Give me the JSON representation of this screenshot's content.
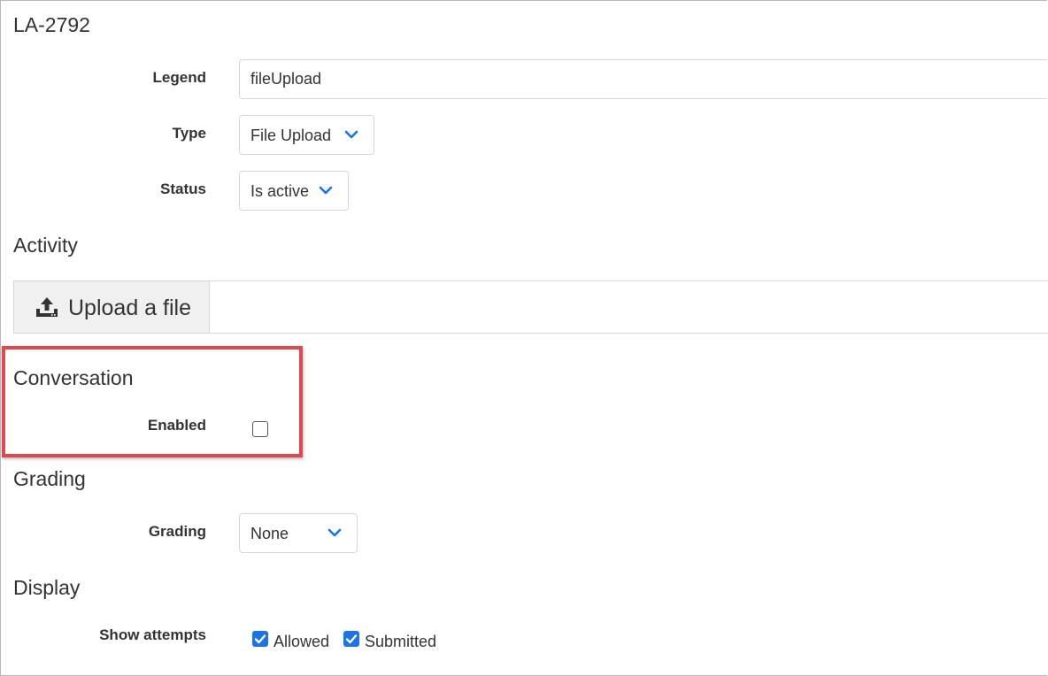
{
  "header": {
    "title": "LA-2792"
  },
  "general": {
    "legend_label": "Legend",
    "legend_value": "fileUpload",
    "type_label": "Type",
    "type_value": "File Upload",
    "status_label": "Status",
    "status_value": "Is active"
  },
  "activity": {
    "title": "Activity",
    "upload_label": "Upload a file",
    "upload_icon": "upload-icon"
  },
  "conversation": {
    "title": "Conversation",
    "enabled_label": "Enabled",
    "enabled_checked": false
  },
  "grading": {
    "title": "Grading",
    "grading_label": "Grading",
    "grading_value": "None"
  },
  "display": {
    "title": "Display",
    "show_attempts_label": "Show attempts",
    "options": [
      {
        "label": "Allowed",
        "checked": true
      },
      {
        "label": "Submitted",
        "checked": true
      }
    ]
  },
  "colors": {
    "accent": "#1a73e8",
    "highlight": "#e0484f",
    "border": "#d7d7d7",
    "text": "#333333"
  }
}
